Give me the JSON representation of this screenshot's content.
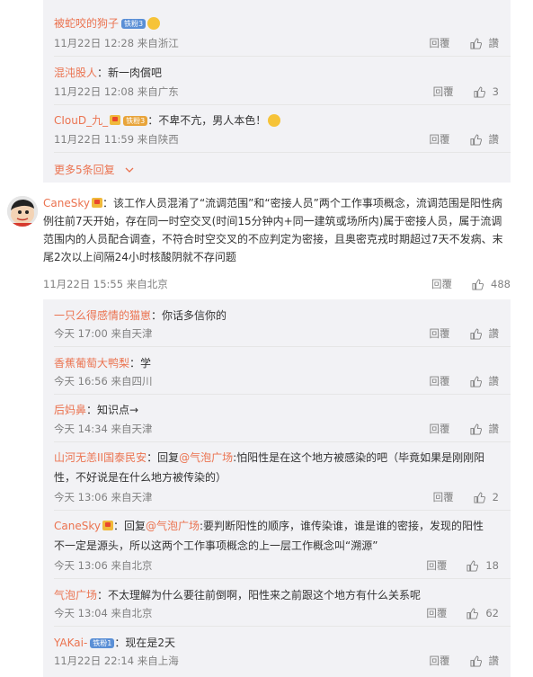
{
  "top_replies": [
    {
      "user": "被蛇咬的狗子",
      "badge": "铁粉3",
      "text": "",
      "time": "11月22日 12:28",
      "loc": "来自浙江",
      "reply": "回覆",
      "likes": "讚"
    },
    {
      "user": "混沌股人",
      "text": "：新一肉償吧",
      "time": "11月22日 12:08",
      "loc": "来自广东",
      "reply": "回覆",
      "likes": "3"
    },
    {
      "user": "CIouD_九_",
      "badge": "铁粉3",
      "text": "：不卑不亢，男人本色！",
      "time": "11月22日 11:59",
      "loc": "来自陕西",
      "reply": "回覆",
      "likes": "讚"
    }
  ],
  "more_replies": "更多5条回复",
  "main": {
    "user": "CaneSky",
    "text": "：该工作人员混淆了“流调范围”和“密接人员”两个工作事项概念，流调范围是阳性病例往前7天开始，存在同一时空交叉(时间15分钟内+同一建筑或场所内)属于密接人员，属于流调范围内的人员配合调查，不符合时空交叉的不应判定为密接，且奥密克戎时期超过7天不发病、末尾2次以上间隔24小时核酸阴就不存问题",
    "time": "11月22日 15:55",
    "loc": "来自北京",
    "reply": "回覆",
    "likes": "488"
  },
  "sub_replies": [
    {
      "user": "一只么得感情的猫崽",
      "text": "：你话多信你的",
      "time": "今天 17:00",
      "loc": "来自天津",
      "reply": "回覆",
      "likes": "讚"
    },
    {
      "user": "香蕉葡萄大鸭梨",
      "text": "：学",
      "time": "今天 16:56",
      "loc": "来自四川",
      "reply": "回覆",
      "likes": "讚"
    },
    {
      "user": "后妈鼻",
      "text": "：知识点→",
      "time": "今天 14:34",
      "loc": "来自天津",
      "reply": "回覆",
      "likes": "讚"
    },
    {
      "user": "山河无恙II国泰民安",
      "text_prefix": "：回复",
      "mention": "@气泡广场",
      "text": ":怕阳性是在这个地方被感染的吧（毕竟如果是刚刚阳性，不好说是在什么地方被传染的）",
      "time": "今天 13:06",
      "loc": "来自天津",
      "reply": "回覆",
      "likes": "2"
    },
    {
      "user": "CaneSky",
      "text_prefix": "：回复",
      "mention": "@气泡广场",
      "text": ":要判断阳性的顺序，谁传染谁，谁是谁的密接，发现的阳性不一定是源头，所以这两个工作事项概念的上一层工作概念叫“溯源”",
      "time": "今天 13:06",
      "loc": "来自北京",
      "reply": "回覆",
      "likes": "18"
    },
    {
      "user": "气泡广场",
      "text": "：不太理解为什么要往前倒啊，阳性来之前跟这个地方有什么关系呢",
      "time": "今天 13:04",
      "loc": "来自北京",
      "reply": "回覆",
      "likes": "62"
    },
    {
      "user": "YAKai-",
      "badge": "铁粉1",
      "text": "：现在是2天",
      "time": "11月22日 22:14",
      "loc": "来自上海",
      "reply": "回覆",
      "likes": "讚"
    }
  ]
}
